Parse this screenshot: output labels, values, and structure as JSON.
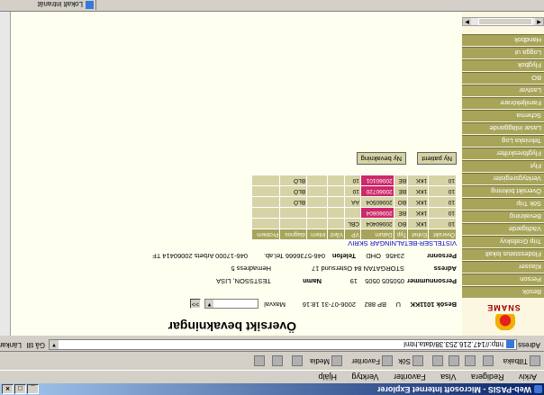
{
  "window": {
    "title": "Web-PASIS - Microsoft Internet Explorer",
    "buttons": [
      "_",
      "□",
      "×"
    ]
  },
  "menu": [
    "Arkiv",
    "Redigera",
    "Visa",
    "Favoriter",
    "Verktyg",
    "Hjälp"
  ],
  "toolbar": {
    "back": "Tillbaka",
    "search": "Sök",
    "favorites": "Favoriter",
    "media": "Media"
  },
  "address": {
    "label": "Adress",
    "url": "http://147.216.253.38/data.html",
    "go": "Gå till",
    "links": "Länkar"
  },
  "sidebar": {
    "logo": "SNAME",
    "items": [
      "Besök",
      "Person",
      "Klasser",
      "Flödesstatus lokalt",
      "Trip Grafiskvy",
      "Vädtigarde",
      "Bevakning",
      "Sök Trip",
      "Översikt bokning",
      "Verktygsregister",
      "Flyt",
      "Flygföreskrifter",
      "Tekniska Log",
      "Lasar inläggande",
      "Schema",
      "Familjekörare",
      "Lastvar",
      "BO",
      "Flygbok",
      "Logga ut",
      "Handbok"
    ]
  },
  "page": {
    "title": "Översikt bevakningar"
  },
  "row1": {
    "a": "Besök 1011KK",
    "b": "U",
    "c": "BP 882",
    "d": "2006-07-31 18:16",
    "e": "Maxval",
    "btn": ">>"
  },
  "info": {
    "link": "VISTELSER-BETALNINGAR SKRIV",
    "l1": {
      "k1": "Personnr",
      "v1": "23456",
      "k2": "OHD",
      "k3": "Telefon",
      "v3": "046-5736666 Tel.ab.",
      "v4": "046-17000 Arbets 20060414 TF"
    },
    "l2": {
      "k1": "Adress",
      "v1": "STORGATAN 84 Ostersund 17",
      "k3": "Hemadress 5"
    },
    "l3": {
      "k1": "Personnummer",
      "v1": "050505 0505",
      "v2": "19",
      "k3": "Namn",
      "v3": "TESTSSON, LISA"
    }
  },
  "table": {
    "headers": [
      "Översikt",
      "Enhet",
      "Typ",
      "Datum",
      "VP",
      "Vård",
      "Intern",
      "diagnos",
      "Problem"
    ],
    "rows": [
      [
        "10",
        "1KK",
        "BO",
        "20060404",
        "CBL",
        "",
        "",
        "",
        ""
      ],
      [
        "10",
        "1KK",
        "BE",
        "20060604",
        "",
        "",
        "",
        "",
        ""
      ],
      [
        "10",
        "1KK",
        "BO",
        "20060504",
        "AA",
        "",
        "",
        "BLÖ",
        ""
      ],
      [
        "10",
        "1KK",
        "BE",
        "20060720",
        "10",
        "",
        "",
        "BLÖ",
        ""
      ],
      [
        "10",
        "1KK",
        "BE",
        "20060101",
        "10",
        "",
        "",
        "BLÖ",
        ""
      ]
    ],
    "highlight_color": "#cc2a6a"
  },
  "tabs": {
    "tab1": "Ny patient",
    "tab2": "Ny bevakning"
  },
  "status": {
    "text": "",
    "zone": "Lokalt intranät"
  },
  "colors": {
    "nav": "#a8a45a",
    "content_bg": "#fffff0",
    "cell": "#d6d3a6",
    "highlight": "#cc2a6a"
  }
}
